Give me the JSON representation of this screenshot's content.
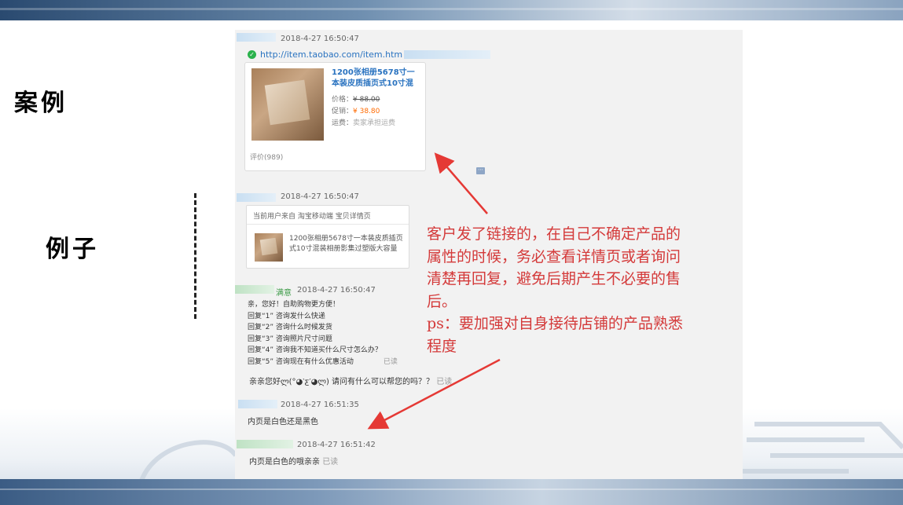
{
  "slide": {
    "side_title_1": "案例",
    "side_title_2": "例子"
  },
  "chat": {
    "msg1": {
      "timestamp": "2018-4-27 16:50:47",
      "link_text": "http://item.taobao.com/item.htm",
      "product": {
        "title": "1200张相册5678寸一本装皮质插页式10寸混",
        "price_label": "价格：",
        "price_value": "¥ 88.00",
        "promo_label": "促销：",
        "promo_value": "¥ 38.80",
        "shipping_label": "运费：",
        "shipping_value": "卖家承担运费",
        "reviews": "评价(989)"
      }
    },
    "msg2": {
      "timestamp": "2018-4-27 16:50:47",
      "header": "当前用户来自 淘宝移动端 宝贝详情页",
      "description": "1200张相册5678寸一本装皮质插页式10寸混装相册影集过塑版大容量"
    },
    "msg3": {
      "sender_suffix": "满意",
      "timestamp": "2018-4-27 16:50:47",
      "lines": [
        "亲，您好！自助购物更方便！",
        "回复“1”  咨询发什么快递",
        "回复“2”  咨询什么时候发货",
        "回复“3”  咨询照片尺寸问题",
        "回复“4”  咨询我不知道买什么尺寸怎么办？",
        "回复“5”  咨询现在有什么优惠活动"
      ],
      "read_status": "已读",
      "followup": "亲亲您好ლ(°◕‵ƹ′◕ლ) 请问有什么可以帮您的吗？？",
      "followup_read": "已读"
    },
    "msg4": {
      "timestamp": "2018-4-27 16:51:35",
      "text": "内页是白色还是黑色"
    },
    "msg5": {
      "timestamp": "2018-4-27 16:51:42",
      "text": "内页是白色的哦亲亲",
      "read_status": "已读"
    }
  },
  "annotation": {
    "line1": "客户发了链接的，在自己不确定产品的",
    "line2": "属性的时候，务必查看详情页或者询问",
    "line3": "清楚再回复，避免后期产生不必要的售",
    "line4": "后。",
    "line5": "ps：要加强对自身接待店铺的产品熟悉",
    "line6": "程度",
    "color": "#d43a3a"
  }
}
